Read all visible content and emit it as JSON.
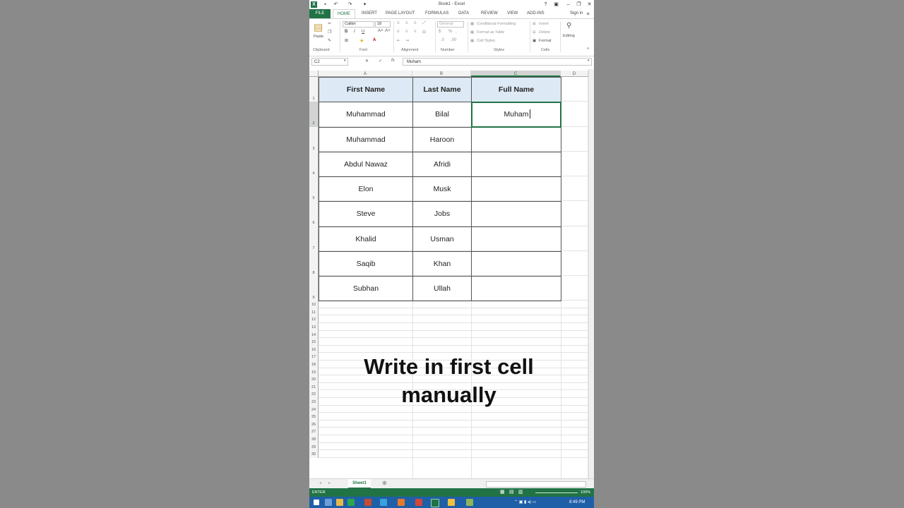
{
  "window": {
    "title": "Book1 - Excel",
    "sign_in": "Sign in",
    "help": "?",
    "min": "–",
    "restore": "❐",
    "close": "✕"
  },
  "ribbon_tabs": [
    "FILE",
    "HOME",
    "INSERT",
    "PAGE LAYOUT",
    "FORMULAS",
    "DATA",
    "REVIEW",
    "VIEW",
    "ADD-INS"
  ],
  "ribbon": {
    "paste_label": "Paste",
    "font_name": "Calibri",
    "font_size": "18",
    "number_format": "General",
    "conditional_formatting": "Conditional Formatting",
    "format_as_table": "Format as Table",
    "cell_styles": "Cell Styles",
    "insert": "Insert",
    "delete": "Delete",
    "format": "Format",
    "editing": "Editing",
    "groups": [
      "Clipboard",
      "Font",
      "Alignment",
      "Number",
      "Styles",
      "Cells"
    ]
  },
  "formula_bar": {
    "name_box": "C2",
    "fx": "fx",
    "content": "Muham"
  },
  "columns": [
    "A",
    "B",
    "C",
    "D"
  ],
  "row_numbers": [
    "1",
    "2",
    "3",
    "4",
    "5",
    "6",
    "7",
    "8",
    "9",
    "10",
    "11",
    "12",
    "13",
    "14",
    "15",
    "16",
    "17",
    "18",
    "19",
    "20",
    "21",
    "22",
    "23",
    "24",
    "25",
    "26",
    "27",
    "28",
    "29",
    "30"
  ],
  "table": {
    "headers": [
      "First Name",
      "Last Name",
      "Full Name"
    ],
    "rows": [
      [
        "Muhammad",
        "Bilal",
        "Muham"
      ],
      [
        "Muhammad",
        "Haroon",
        ""
      ],
      [
        "Abdul Nawaz",
        "Afridi",
        ""
      ],
      [
        "Elon",
        "Musk",
        ""
      ],
      [
        "Steve",
        "Jobs",
        ""
      ],
      [
        "Khalid",
        "Usman",
        ""
      ],
      [
        "Saqib",
        "Khan",
        ""
      ],
      [
        "Subhan",
        "Ullah",
        ""
      ]
    ]
  },
  "caption": {
    "line1": "Write in first cell",
    "line2": "manually"
  },
  "sheet_tab": "Sheet1",
  "status": {
    "mode": "ENTER",
    "zoom": "100%"
  },
  "taskbar": {
    "time": "8:49 PM"
  },
  "colors": {
    "excel_green": "#217346",
    "header_fill": "#dde9f4",
    "taskbar": "#1e5fa8"
  }
}
